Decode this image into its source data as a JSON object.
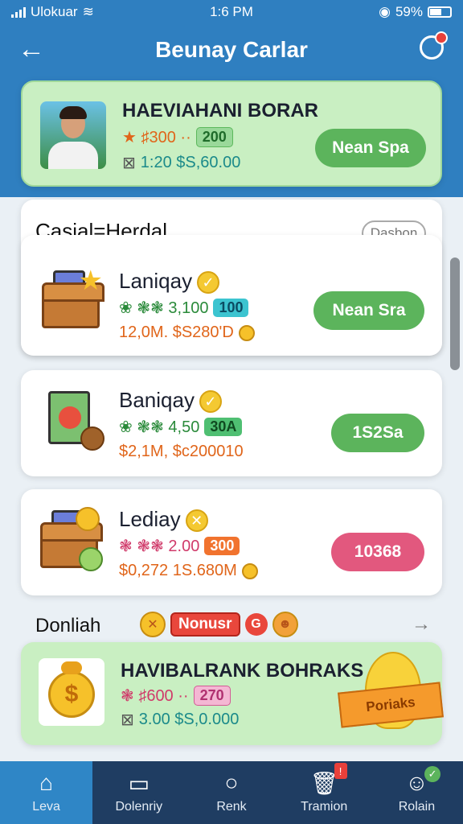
{
  "status": {
    "carrier": "Ulokuar",
    "time": "1:6 PM",
    "battery": "59%"
  },
  "header": {
    "title": "Beunay Carlar"
  },
  "hero": {
    "name": "HAEVIAHANI BORAR",
    "line1_text": "★ ♯300 ··",
    "line1_badge": "200",
    "line2_text": "1:20 $S,60.00",
    "button": "Nean Spa"
  },
  "section": {
    "title": "Casial=Herdal",
    "action": "Dasbon"
  },
  "items": [
    {
      "name": "Laniqay",
      "line1_text": "❀ ❃❃ 3,100",
      "line1_badge": "100",
      "line2_text": "12,0M. $S280'D",
      "button": "Nean Sra"
    },
    {
      "name": "Baniqay",
      "line1_text": "❀ ❃❃ 4,50",
      "line1_badge": "30A",
      "line2_text": "$2,1M, $c200010",
      "button": "1S2Sa"
    },
    {
      "name": "Lediay",
      "line1_text": "❃ ❃❃ 2.00",
      "line1_badge": "300",
      "line2_text": "$0,272 1S.680M",
      "button": "10368"
    }
  ],
  "bonus": {
    "title": "Donliah",
    "tag": "Nonusr",
    "card_name": "HAVIBALRANK BOHRAKS",
    "line1_text": "❃ ♯600 ··",
    "line1_badge": "270",
    "line2_text": "3.00 $S,0.000",
    "ribbon": "Poriaks"
  },
  "nav": [
    {
      "label": "Leva"
    },
    {
      "label": "Dolenriy"
    },
    {
      "label": "Renk"
    },
    {
      "label": "Tramion"
    },
    {
      "label": "Rolain"
    }
  ],
  "colors": {
    "header_blue": "#2f7fc0",
    "nav_blue": "#1f3d62",
    "accent_green": "#5cb45c",
    "accent_pink": "#e2587e",
    "hero_bg": "#c9efc2"
  }
}
